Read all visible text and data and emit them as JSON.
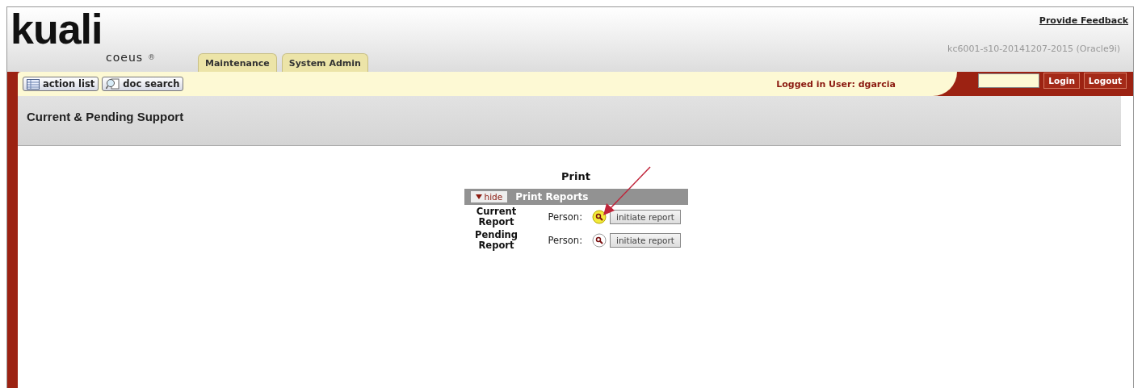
{
  "header": {
    "logo": {
      "word": "kuali",
      "product": "coeus",
      "mark": "®"
    },
    "tabs": [
      {
        "label": "Maintenance",
        "selected": false
      },
      {
        "label": "System Admin",
        "selected": false
      }
    ],
    "feedback_link": "Provide Feedback",
    "build_info": "kc6001-s10-20141207-2015 (Oracle9i)"
  },
  "toolbar": {
    "buttons": [
      {
        "label": "action list",
        "kind": "list"
      },
      {
        "label": "doc search",
        "kind": "search"
      }
    ],
    "logged_in": "Logged in User: dgarcia",
    "login_button": "Login",
    "logout_button": "Logout"
  },
  "page_title": "Current & Pending Support",
  "print": {
    "title": "Print",
    "section": {
      "toggle": "hide",
      "expanded": true,
      "title": "Print Reports"
    },
    "rows": [
      {
        "label_line1": "Current",
        "label_line2": "Report",
        "field_label": "Person:",
        "highlighted": true,
        "button": "initiate report"
      },
      {
        "label_line1": "Pending",
        "label_line2": "Report",
        "field_label": "Person:",
        "highlighted": false,
        "button": "initiate report"
      }
    ]
  }
}
